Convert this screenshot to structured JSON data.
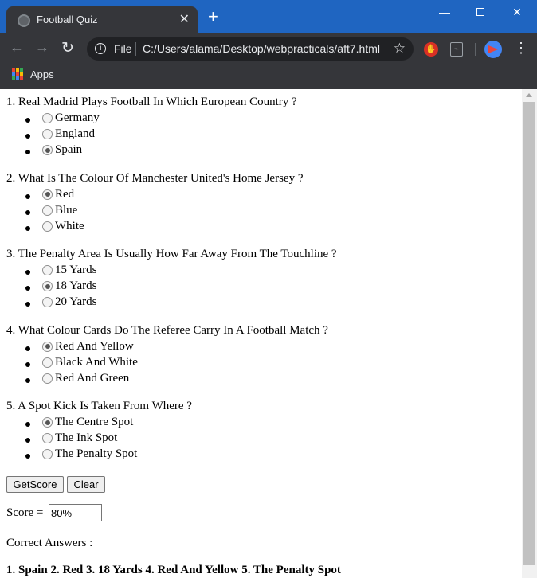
{
  "browser": {
    "tab_title": "Football Quiz",
    "tab_close": "✕",
    "new_tab": "+",
    "window_minimize": "—",
    "window_close": "✕",
    "nav_back": "←",
    "nav_forward": "→",
    "nav_reload": "↻",
    "info": "i",
    "file_label": "File",
    "url": "C:/Users/alama/Desktop/webpracticals/aft7.html",
    "star": "☆",
    "menu": "⋮",
    "bookmark_apps": "Apps",
    "apps_colors": [
      "#ea4335",
      "#fbbc04",
      "#34a853",
      "#4285f4",
      "#ea4335",
      "#fbbc04",
      "#34a853",
      "#4285f4",
      "#ea4335"
    ]
  },
  "quiz": {
    "questions": [
      {
        "text": "1. Real Madrid Plays Football In Which European Country ?",
        "options": [
          {
            "label": "Germany",
            "checked": false
          },
          {
            "label": "England",
            "checked": false
          },
          {
            "label": "Spain",
            "checked": true
          }
        ]
      },
      {
        "text": "2. What Is The Colour Of Manchester United's Home Jersey ?",
        "options": [
          {
            "label": "Red",
            "checked": true
          },
          {
            "label": "Blue",
            "checked": false
          },
          {
            "label": "White",
            "checked": false
          }
        ]
      },
      {
        "text": "3. The Penalty Area Is Usually How Far Away From The Touchline ?",
        "options": [
          {
            "label": "15 Yards",
            "checked": false
          },
          {
            "label": "18 Yards",
            "checked": true
          },
          {
            "label": "20 Yards",
            "checked": false
          }
        ]
      },
      {
        "text": "4. What Colour Cards Do The Referee Carry In A Football Match ?",
        "options": [
          {
            "label": "Red And Yellow",
            "checked": true
          },
          {
            "label": "Black And White",
            "checked": false
          },
          {
            "label": "Red And Green",
            "checked": false
          }
        ]
      },
      {
        "text": "5. A Spot Kick Is Taken From Where ?",
        "options": [
          {
            "label": "The Centre Spot",
            "checked": true
          },
          {
            "label": "The Ink Spot",
            "checked": false
          },
          {
            "label": "The Penalty Spot",
            "checked": false
          }
        ]
      }
    ],
    "get_score_label": "GetScore",
    "clear_label": "Clear",
    "score_label": "Score =",
    "score_value": "80%",
    "correct_label": "Correct Answers :",
    "correct_answers": "1. Spain 2. Red 3. 18 Yards 4. Red And Yellow 5. The Penalty Spot"
  }
}
